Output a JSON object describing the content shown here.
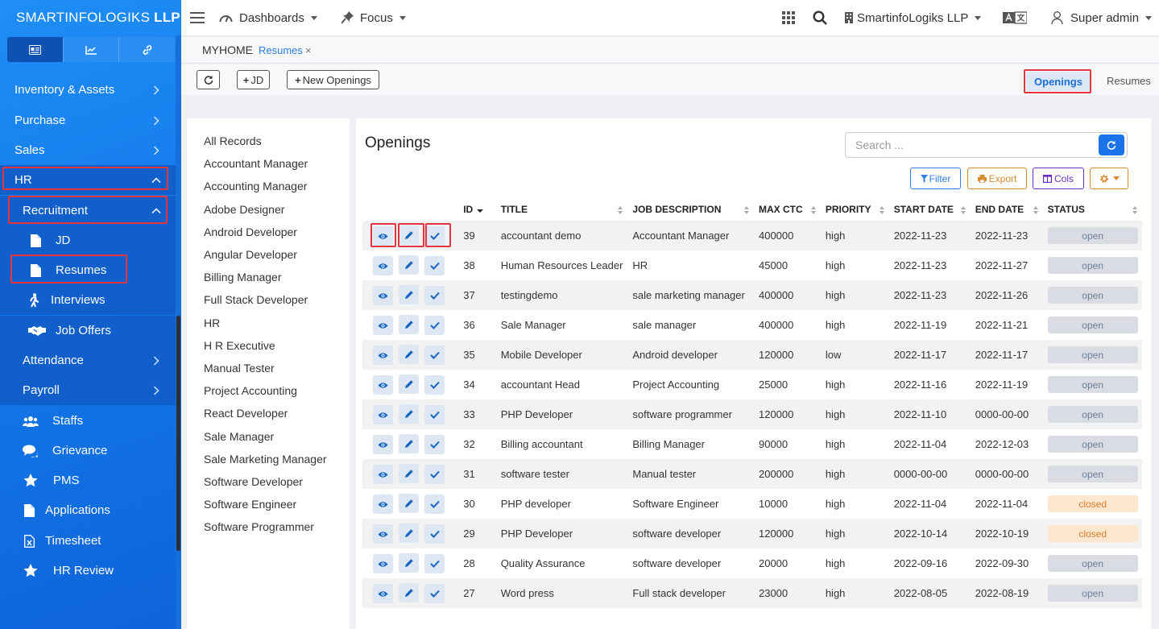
{
  "brand": {
    "name": "SMARTINFOLOGIKS",
    "suffix": "LLP"
  },
  "sidebar": {
    "tabs": [
      {
        "icon": "id-card-icon"
      },
      {
        "icon": "chart-line-icon"
      },
      {
        "icon": "link-icon"
      }
    ],
    "items": [
      {
        "label": "Inventory & Assets"
      },
      {
        "label": "Purchase"
      },
      {
        "label": "Sales"
      },
      {
        "label": "HR"
      },
      {
        "label": "Recruitment"
      },
      {
        "label": "JD"
      },
      {
        "label": "Resumes"
      },
      {
        "label": "Interviews"
      },
      {
        "label": "Job Offers"
      },
      {
        "label": "Attendance"
      },
      {
        "label": "Payroll"
      },
      {
        "label": "Staffs"
      },
      {
        "label": "Grievance"
      },
      {
        "label": "PMS"
      },
      {
        "label": "Applications"
      },
      {
        "label": "Timesheet"
      },
      {
        "label": "HR Review"
      }
    ]
  },
  "topbar": {
    "dashboards": "Dashboards",
    "focus": "Focus",
    "company": "SmartinfoLogiks LLP",
    "user": "Super admin"
  },
  "breadcrumb": {
    "home": "MYHOME",
    "current": "Resumes",
    "close": "×"
  },
  "actions": {
    "jd": "JD",
    "new_openings": "New Openings",
    "tab_openings": "Openings",
    "tab_resumes": "Resumes"
  },
  "categories": [
    "All Records",
    "Accountant Manager",
    "Accounting Manager",
    "Adobe Designer",
    "Android Developer",
    "Angular Developer",
    "Billing Manager",
    "Full Stack Developer",
    "HR",
    "H R Executive",
    "Manual Tester",
    "Project Accounting",
    "React Developer",
    "Sale Manager",
    "Sale Marketing Manager",
    "Software Developer",
    "Software Engineer",
    "Software Programmer"
  ],
  "panel": {
    "title": "Openings",
    "search_placeholder": "Search ...",
    "filter": "Filter",
    "export": "Export",
    "cols": "Cols"
  },
  "table": {
    "headers": [
      "ID",
      "TITLE",
      "JOB DESCRIPTION",
      "MAX CTC",
      "PRIORITY",
      "START DATE",
      "END DATE",
      "STATUS"
    ],
    "rows": [
      [
        "39",
        "accountant demo",
        "Accountant Manager",
        "400000",
        "high",
        "2022-11-23",
        "2022-11-23",
        "open"
      ],
      [
        "38",
        "Human Resources Leader",
        "HR",
        "45000",
        "high",
        "2022-11-23",
        "2022-11-27",
        "open"
      ],
      [
        "37",
        "testingdemo",
        "sale marketing manager",
        "400000",
        "high",
        "2022-11-23",
        "2022-11-26",
        "open"
      ],
      [
        "36",
        "Sale Manager",
        "sale manager",
        "400000",
        "high",
        "2022-11-19",
        "2022-11-21",
        "open"
      ],
      [
        "35",
        "Mobile Developer",
        "Android developer",
        "120000",
        "low",
        "2022-11-17",
        "2022-11-17",
        "open"
      ],
      [
        "34",
        "accountant Head",
        "Project Accounting",
        "25000",
        "high",
        "2022-11-16",
        "2022-11-19",
        "open"
      ],
      [
        "33",
        "PHP Developer",
        "software programmer",
        "120000",
        "high",
        "2022-11-10",
        "0000-00-00",
        "open"
      ],
      [
        "32",
        "Billing accountant",
        "Billing Manager",
        "90000",
        "high",
        "2022-11-04",
        "2022-12-03",
        "open"
      ],
      [
        "31",
        "software tester",
        "Manual tester",
        "200000",
        "high",
        "0000-00-00",
        "0000-00-00",
        "open"
      ],
      [
        "30",
        "PHP developer",
        "Software Engineer",
        "10000",
        "high",
        "2022-11-04",
        "2022-11-04",
        "closed"
      ],
      [
        "29",
        "PHP Developer",
        "software developer",
        "120000",
        "high",
        "2022-10-14",
        "2022-10-19",
        "closed"
      ],
      [
        "28",
        "Quality Assurance",
        "software developer",
        "20000",
        "high",
        "2022-09-16",
        "2022-09-30",
        "open"
      ],
      [
        "27",
        "Word press",
        "Full stack developer",
        "23000",
        "high",
        "2022-08-05",
        "2022-08-19",
        "open"
      ]
    ]
  },
  "colors": {
    "accent": "#1a73e8",
    "sidebar": "#1379ea",
    "highlight": "#e2353e",
    "open_bg": "#d9dde3",
    "closed_bg": "#fde8cf"
  }
}
